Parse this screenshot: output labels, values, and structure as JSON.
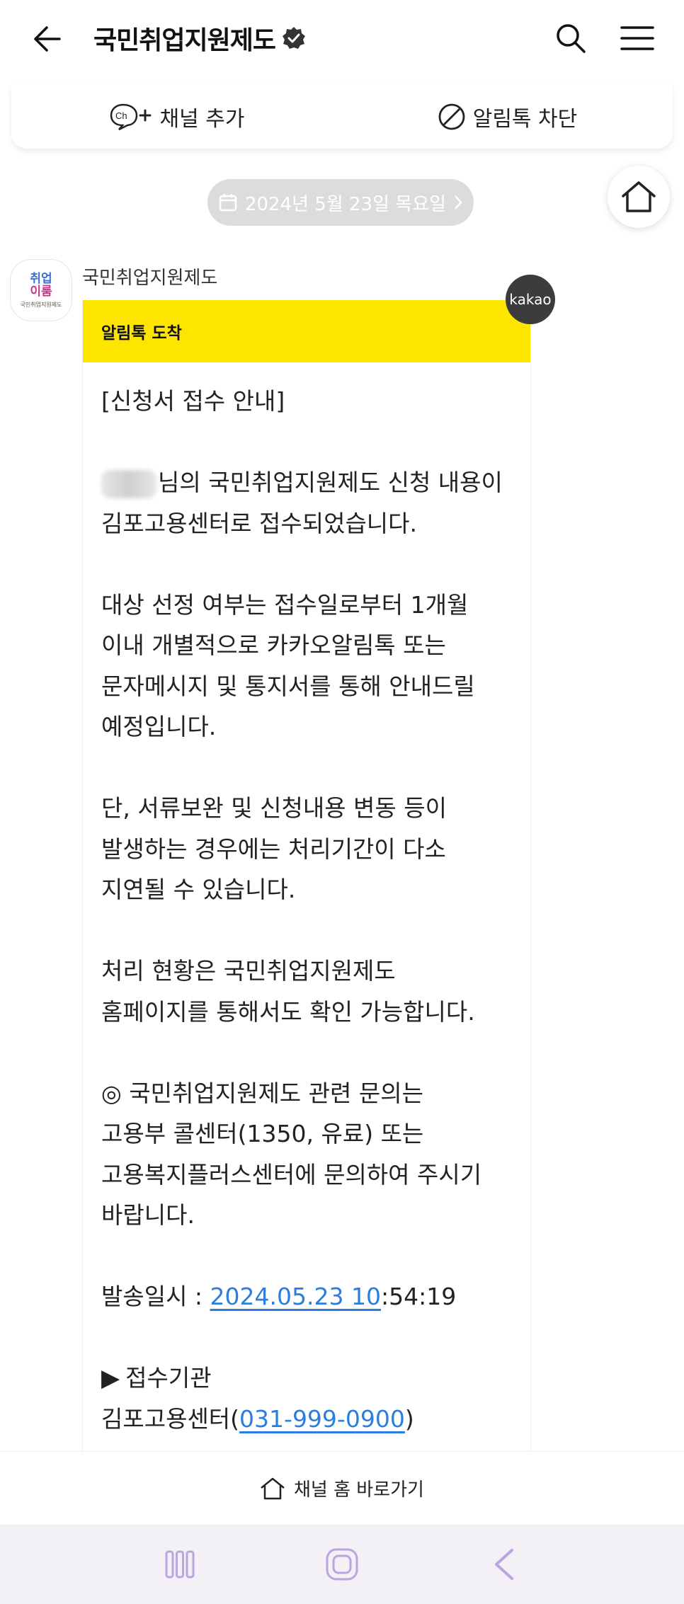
{
  "header": {
    "title": "국민취업지원제도",
    "back_icon": "arrow-left-icon",
    "verified_icon": "verified-badge-icon",
    "search_icon": "search-icon",
    "menu_icon": "hamburger-menu-icon"
  },
  "actions": {
    "add_channel_label": "채널 추가",
    "block_label": "알림톡 차단"
  },
  "date_pill": {
    "label": "2024년 5월 23일 목요일"
  },
  "message": {
    "sender_name": "국민취업지원제도",
    "avatar_line1": "취업",
    "avatar_line2": "이룸",
    "avatar_caption": "국민취업지원제도",
    "badge": "kakao",
    "header_label": "알림톡 도착",
    "lines": {
      "l1": "[신청서 접수 안내]",
      "l2_suffix": "님의 국민취업지원제도 신청 내용이",
      "l3": "김포고용센터로 접수되었습니다.",
      "l4": "대상 선정 여부는 접수일로부터 1개월",
      "l5": "이내 개별적으로 카카오알림톡 또는",
      "l6": "문자메시지 및 통지서를 통해 안내드릴",
      "l7": "예정입니다.",
      "l8": "단, 서류보완 및 신청내용 변동 등이",
      "l9": "발생하는 경우에는 처리기간이 다소",
      "l10": "지연될 수 있습니다.",
      "l11": "처리 현황은 국민취업지원제도",
      "l12": "홈페이지를 통해서도 확인 가능합니다.",
      "l13": "◎ 국민취업지원제도 관련 문의는",
      "l14": "고용부 콜센터(1350, 유료) 또는",
      "l15": "고용복지플러스센터에 문의하여 주시기",
      "l16": "바랍니다.",
      "sent_prefix": "발송일시 : ",
      "sent_date_link": "2024.05.23 10",
      "sent_time_rest": ":54:19",
      "agency_marker": "▶",
      "agency_label": "접수기관",
      "agency_name": "김포고용센터(",
      "agency_phone": "031-999-0900",
      "agency_close": ")"
    }
  },
  "channel_home": {
    "label": "채널 홈 바로가기"
  },
  "colors": {
    "kakao_yellow": "#fee500",
    "link_blue": "#2b7de0",
    "nav_purple": "#b9a6de"
  }
}
